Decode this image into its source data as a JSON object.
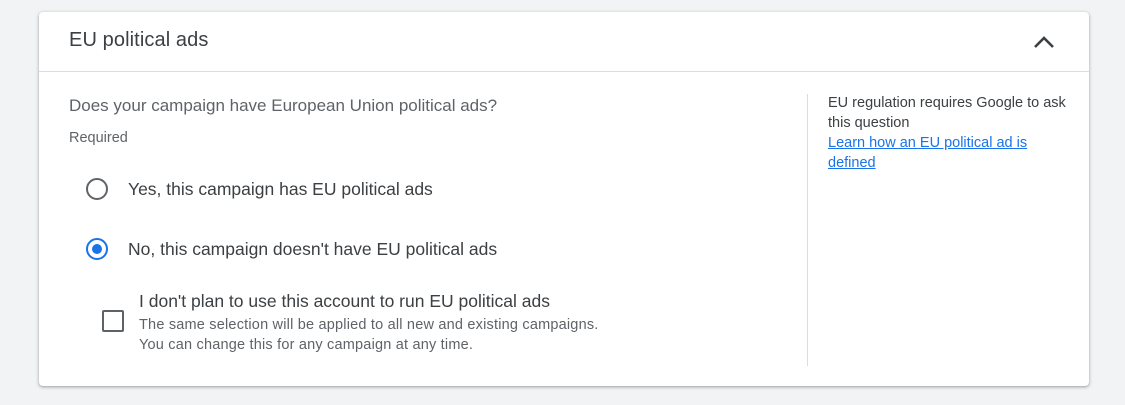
{
  "section": {
    "title": "EU political ads",
    "collapse_icon": "chevron-up-icon"
  },
  "question": {
    "text": "Does your campaign have European Union political ads?",
    "required_label": "Required"
  },
  "options": [
    {
      "label": "Yes, this campaign has EU political ads",
      "selected": false
    },
    {
      "label": "No, this campaign doesn't have EU political ads",
      "selected": true
    }
  ],
  "account_checkbox": {
    "label": "I don't plan to use this account to run EU political ads",
    "help": "The same selection will be applied to all new and existing campaigns. You can change this for any campaign at any time.",
    "checked": false
  },
  "side_panel": {
    "note": "EU regulation requires Google to ask this question",
    "link_text": "Learn how an EU political ad is defined"
  },
  "colors": {
    "accent": "#1a73e8",
    "text_primary": "#3c4043",
    "text_secondary": "#5f6368",
    "background": "#f1f3f4"
  }
}
